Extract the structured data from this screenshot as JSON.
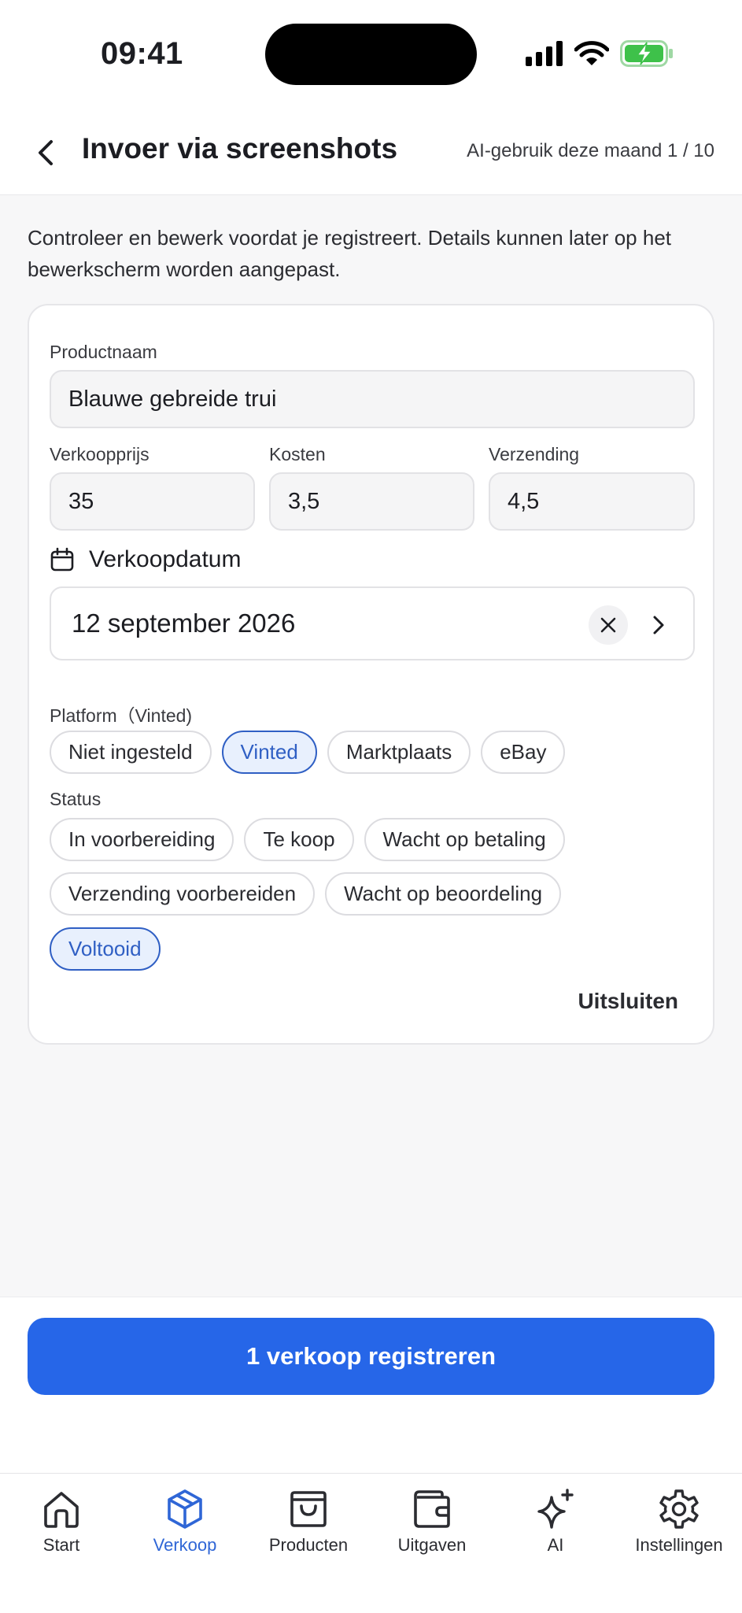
{
  "status_bar": {
    "time": "09:41"
  },
  "header": {
    "title": "Invoer via screenshots",
    "ai_usage": "AI-gebruik deze maand 1 / 10"
  },
  "intro_text": "Controleer en bewerk voordat je registreert. Details kunnen later op het bewerkscherm worden aangepast.",
  "form": {
    "product_name_label": "Productnaam",
    "product_name_value": "Blauwe gebreide trui",
    "price_label": "Verkoopprijs",
    "price_value": "35",
    "cost_label": "Kosten",
    "cost_value": "3,5",
    "shipping_label": "Verzending",
    "shipping_value": "4,5",
    "date_label": "Verkoopdatum",
    "date_value": "12 september 2026",
    "platform_label": "Platform（Vinted)",
    "platforms": [
      {
        "label": "Niet ingesteld",
        "selected": false
      },
      {
        "label": "Vinted",
        "selected": true
      },
      {
        "label": "Marktplaats",
        "selected": false
      },
      {
        "label": "eBay",
        "selected": false
      }
    ],
    "status_label": "Status",
    "statuses": [
      {
        "label": "In voorbereiding",
        "selected": false
      },
      {
        "label": "Te koop",
        "selected": false
      },
      {
        "label": "Wacht op betaling",
        "selected": false
      },
      {
        "label": "Verzending voorbereiden",
        "selected": false
      },
      {
        "label": "Wacht op beoordeling",
        "selected": false
      },
      {
        "label": "Voltooid",
        "selected": true
      }
    ],
    "exclude_label": "Uitsluiten"
  },
  "primary_action_label": "1 verkoop registreren",
  "tabbar": {
    "items": [
      {
        "label": "Start",
        "icon": "home-icon",
        "active": false
      },
      {
        "label": "Verkoop",
        "icon": "package-icon",
        "active": true
      },
      {
        "label": "Producten",
        "icon": "shopping-bag-icon",
        "active": false
      },
      {
        "label": "Uitgaven",
        "icon": "wallet-icon",
        "active": false
      },
      {
        "label": "AI",
        "icon": "sparkle-icon",
        "active": false
      },
      {
        "label": "Instellingen",
        "icon": "gear-icon",
        "active": false
      }
    ]
  },
  "colors": {
    "accent": "#2666e8",
    "selected_chip_bg": "#e8f0fd",
    "selected_chip_border": "#2f5fc4",
    "battery_green": "#3ec14a"
  }
}
